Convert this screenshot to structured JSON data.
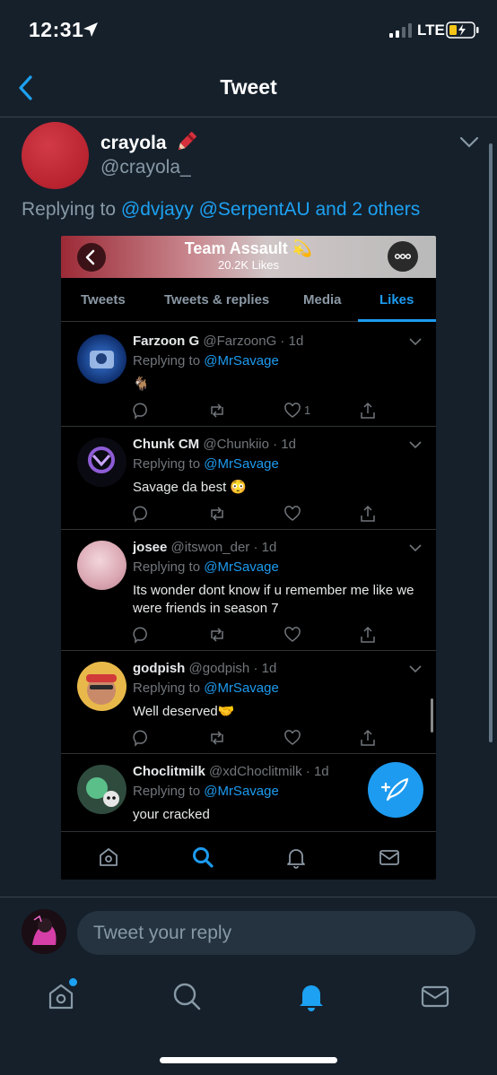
{
  "status_bar": {
    "time": "12:31",
    "network": "LTE"
  },
  "nav": {
    "title": "Tweet"
  },
  "tweet": {
    "display_name": "crayola",
    "handle": "@crayola_",
    "replying_prefix": "Replying to ",
    "replying_mentions": "@dvjayy @SerpentAU and 2 others"
  },
  "screenshot": {
    "profile_name": "Team Assault 💫",
    "likes_count": "20.2K Likes",
    "tabs": [
      {
        "label": "Tweets"
      },
      {
        "label": "Tweets & replies"
      },
      {
        "label": "Media"
      },
      {
        "label": "Likes"
      }
    ],
    "replying_prefix": "Replying to ",
    "items": [
      {
        "name": "Farzoon G",
        "meta": "@FarzoonG · 1d",
        "mention": "@MrSavage",
        "text": "🐐",
        "like_count": "1"
      },
      {
        "name": "Chunk CM",
        "meta": "@Chunkiio · 1d",
        "mention": "@MrSavage",
        "text": "Savage da best 😳",
        "like_count": ""
      },
      {
        "name": "josee",
        "meta": "@itswon_der · 1d",
        "mention": "@MrSavage",
        "text": "Its wonder dont know if u remember me like we were friends in season 7",
        "like_count": ""
      },
      {
        "name": "godpish",
        "meta": "@godpish · 1d",
        "mention": "@MrSavage",
        "text": "Well deserved🤝",
        "like_count": ""
      },
      {
        "name": "Choclitmilk",
        "meta": "@xdChoclitmilk · 1d",
        "mention": "@MrSavage",
        "text": "your cracked",
        "like_count": ""
      }
    ]
  },
  "reply": {
    "placeholder": "Tweet your reply"
  },
  "colors": {
    "background": "#15202b",
    "accent": "#1da1f2",
    "muted": "#8899a6"
  }
}
